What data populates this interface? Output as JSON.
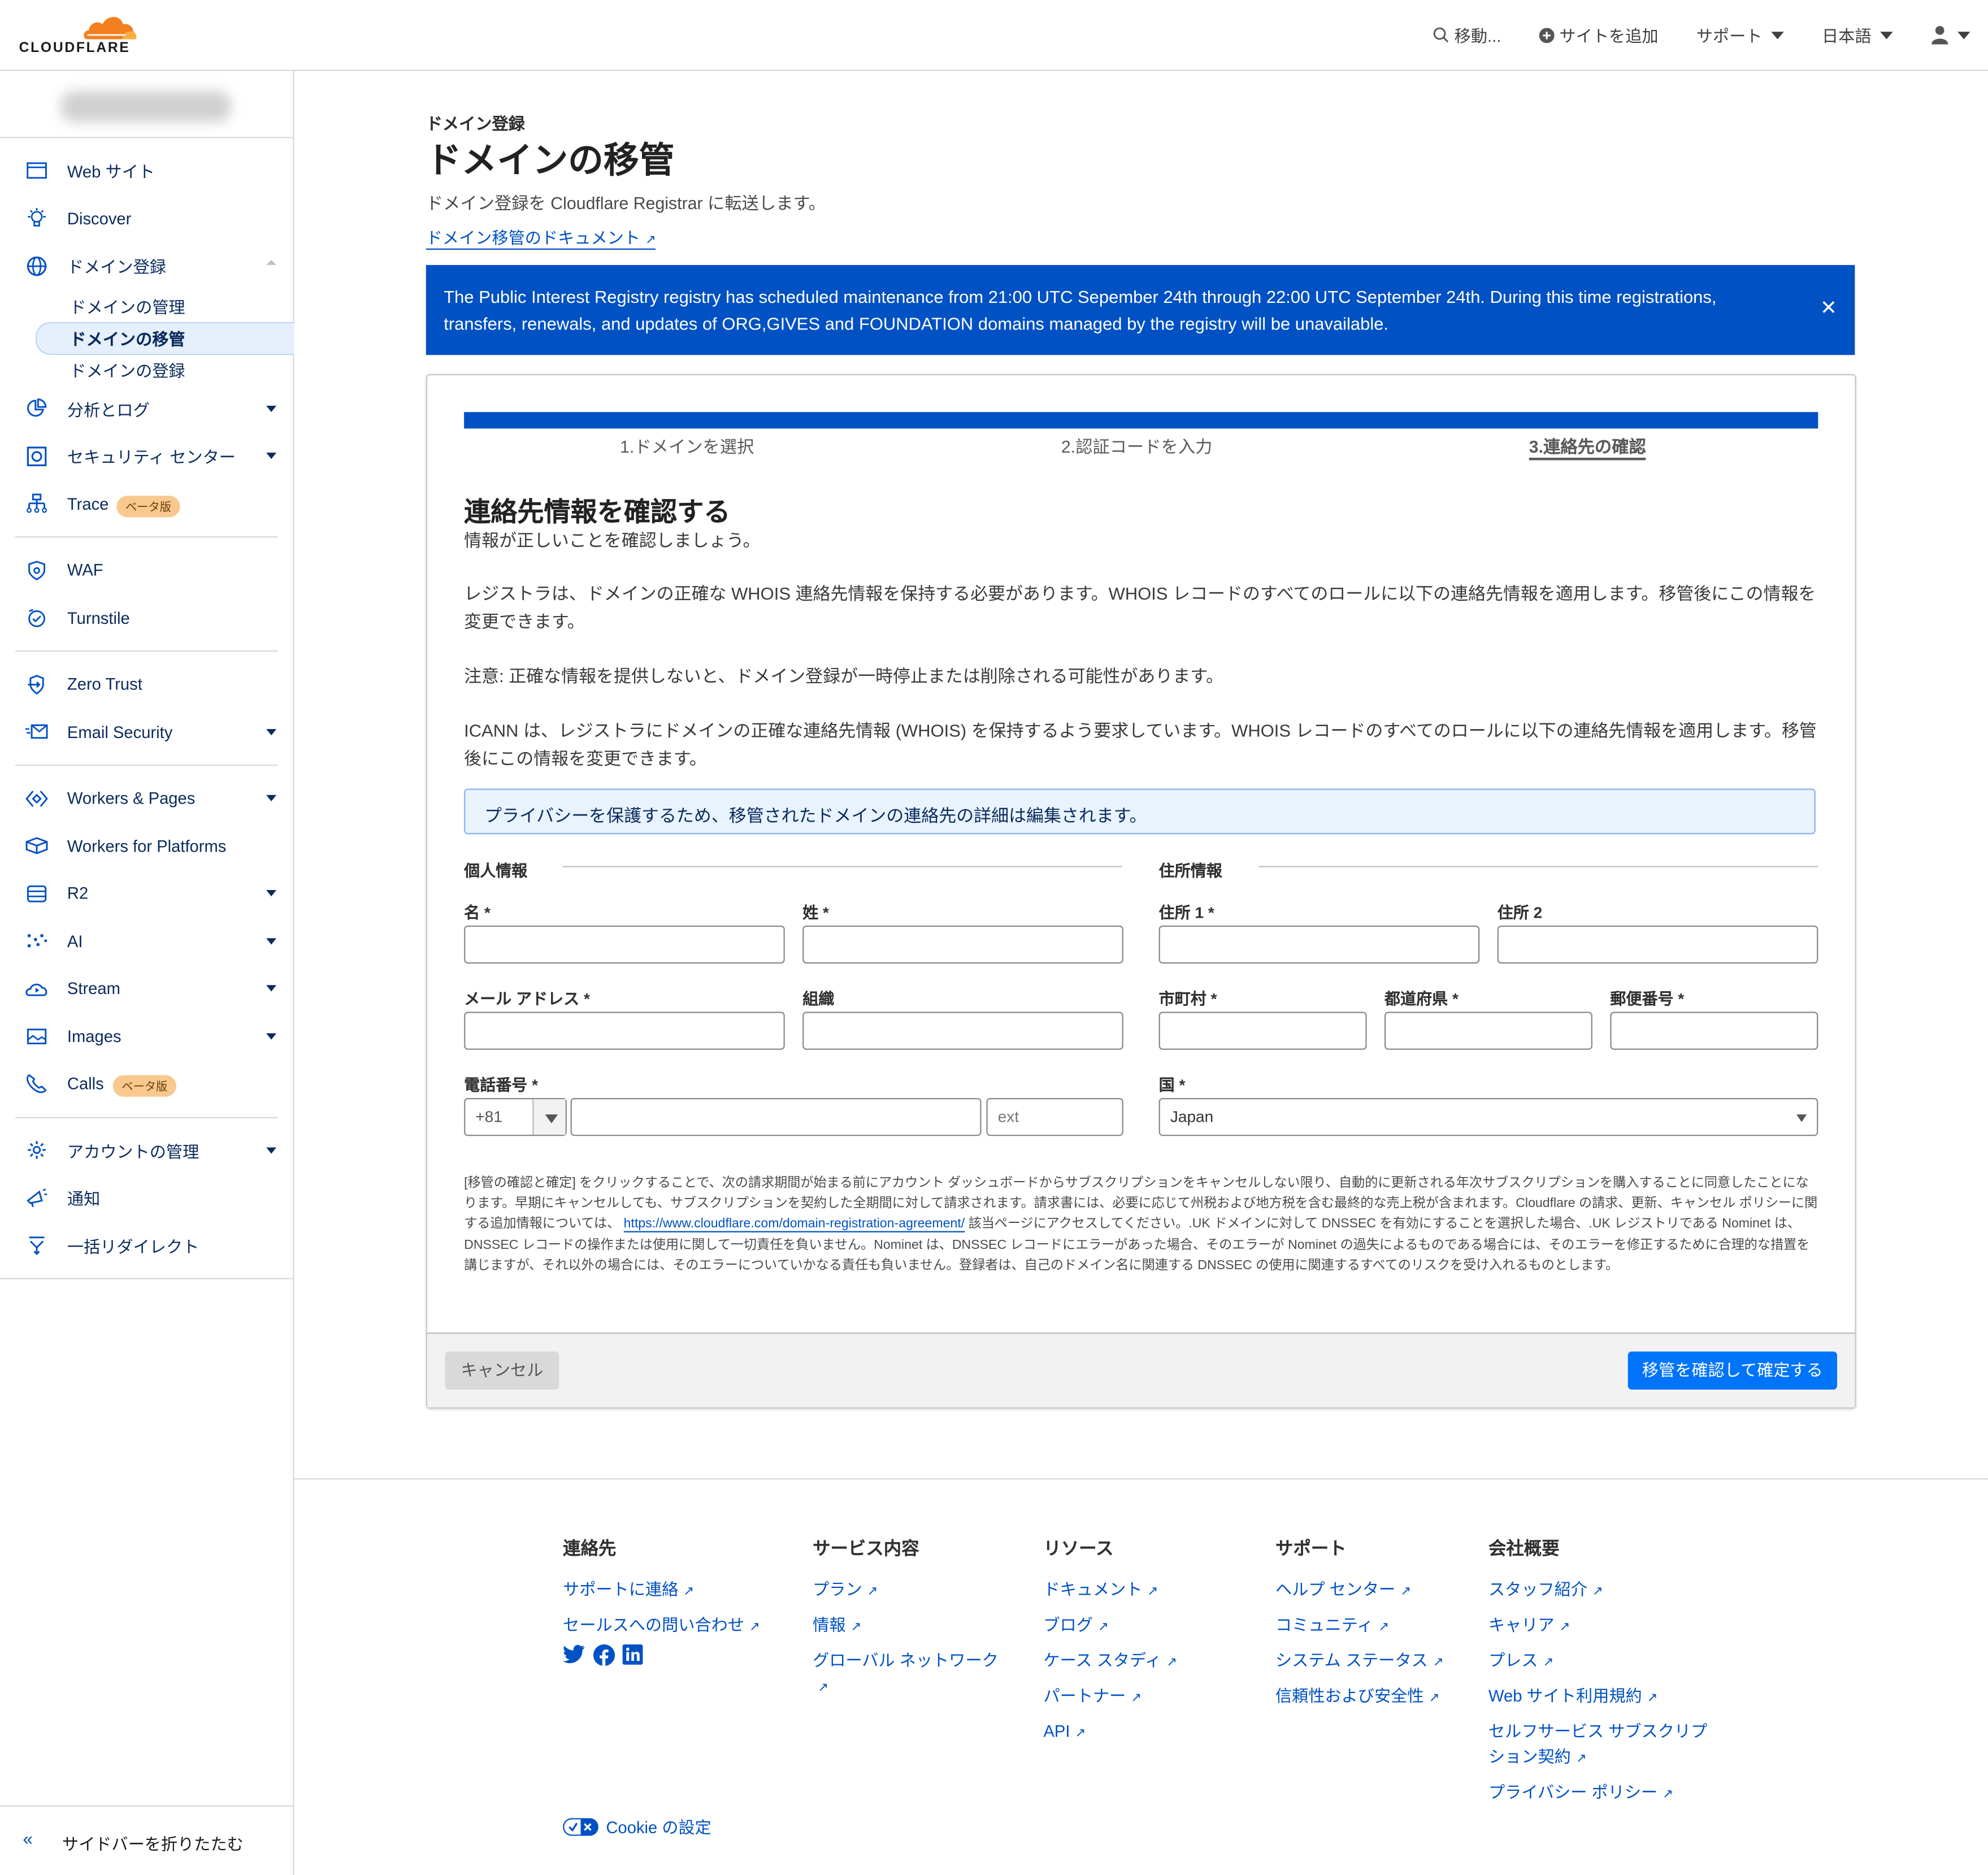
{
  "header": {
    "brand": "CLOUDFLARE",
    "nav": [
      {
        "label": "移動...",
        "icon": "search-icon"
      },
      {
        "label": "サイトを追加",
        "icon": "plus-circle-icon"
      },
      {
        "label": "サポート",
        "dropdown": true
      },
      {
        "label": "日本語",
        "dropdown": true
      },
      {
        "label": "",
        "icon": "user-icon",
        "dropdown": true
      }
    ]
  },
  "sidebar": {
    "items": [
      {
        "label": "Web サイト",
        "icon": "browser-icon"
      },
      {
        "label": "Discover",
        "icon": "lightbulb-icon"
      },
      {
        "label": "ドメイン登録",
        "icon": "globe-icon",
        "expanded": true
      },
      {
        "label": "分析とログ",
        "icon": "pie-chart-icon",
        "dropdown": true
      },
      {
        "label": "セキュリティ センター",
        "icon": "safe-icon",
        "dropdown": true
      },
      {
        "label": "Trace",
        "icon": "network-icon",
        "badge": "ベータ版"
      },
      {
        "label": "WAF",
        "icon": "shield-gear-icon"
      },
      {
        "label": "Turnstile",
        "icon": "turnstile-icon"
      },
      {
        "label": "Zero Trust",
        "icon": "shield-arrow-icon"
      },
      {
        "label": "Email Security",
        "icon": "email-icon",
        "dropdown": true
      },
      {
        "label": "Workers & Pages",
        "icon": "workers-icon",
        "dropdown": true
      },
      {
        "label": "Workers for Platforms",
        "icon": "platforms-icon"
      },
      {
        "label": "R2",
        "icon": "database-icon",
        "dropdown": true
      },
      {
        "label": "AI",
        "icon": "sparkles-icon",
        "dropdown": true
      },
      {
        "label": "Stream",
        "icon": "cloud-play-icon",
        "dropdown": true
      },
      {
        "label": "Images",
        "icon": "image-icon",
        "dropdown": true
      },
      {
        "label": "Calls",
        "icon": "phone-icon",
        "badge": "ベータ版"
      },
      {
        "label": "アカウントの管理",
        "icon": "gear-icon",
        "dropdown": true
      },
      {
        "label": "通知",
        "icon": "megaphone-icon"
      },
      {
        "label": "一括リダイレクト",
        "icon": "redirect-icon"
      }
    ],
    "subitems": [
      {
        "label": "ドメインの管理",
        "active": false
      },
      {
        "label": "ドメインの移管",
        "active": true
      },
      {
        "label": "ドメインの登録",
        "active": false
      }
    ],
    "collapse_label": "サイドバーを折りたたむ"
  },
  "page": {
    "breadcrumb": "ドメイン登録",
    "title": "ドメインの移管",
    "description": "ドメイン登録を Cloudflare Registrar に転送します。",
    "doc_link": "ドメイン移管のドキュメント"
  },
  "banner": {
    "text": "The Public Interest Registry registry has scheduled maintenance from 21:00 UTC Sepember 24th through 22:00 UTC September 24th. During this time registrations, transfers, renewals, and updates of ORG,GIVES and FOUNDATION domains managed by the registry will be unavailable.",
    "close": "✕"
  },
  "wizard": {
    "progress": 1.0,
    "steps": [
      {
        "label": "1.ドメインを選択",
        "current": false
      },
      {
        "label": "2.認証コードを入力",
        "current": false
      },
      {
        "label": "3.連絡先の確認",
        "current": true
      }
    ],
    "heading": "連絡先情報を確認する",
    "subheading": "情報が正しいことを確認しましょう。",
    "para1": "レジストラは、ドメインの正確な WHOIS 連絡先情報を保持する必要があります。WHOIS レコードのすべてのロールに以下の連絡先情報を適用します。移管後にこの情報を変更できます。",
    "para2": "注意: 正確な情報を提供しないと、ドメイン登録が一時停止または削除される可能性があります。",
    "para3": "ICANN は、レジストラにドメインの正確な連絡先情報 (WHOIS) を保持するよう要求しています。WHOIS レコードのすべてのロールに以下の連絡先情報を適用します。移管後にこの情報を変更できます。",
    "privacy_note": "プライバシーを保護するため、移管されたドメインの連絡先の詳細は編集されます。",
    "personal_section": "個人情報",
    "address_section": "住所情報",
    "fields": {
      "first_name": {
        "label": "名 *",
        "value": ""
      },
      "last_name": {
        "label": "姓 *",
        "value": ""
      },
      "email": {
        "label": "メール アドレス *",
        "value": ""
      },
      "org": {
        "label": "組織",
        "value": ""
      },
      "phone": {
        "label": "電話番号 *",
        "country_code": "+81",
        "value": "",
        "ext_placeholder": "ext"
      },
      "address1": {
        "label": "住所 1 *",
        "value": ""
      },
      "address2": {
        "label": "住所 2",
        "value": ""
      },
      "city": {
        "label": "市町村 *",
        "value": ""
      },
      "state": {
        "label": "都道府県 *",
        "value": ""
      },
      "zip": {
        "label": "郵便番号 *",
        "value": ""
      },
      "country": {
        "label": "国 *",
        "value": "Japan"
      }
    },
    "legal_pre": "[移管の確認と確定] をクリックすることで、次の請求期間が始まる前にアカウント ダッシュボードからサブスクリプションをキャンセルしない限り、自動的に更新される年次サブスクリプションを購入することに同意したことになります。早期にキャンセルしても、サブスクリプションを契約した全期間に対して請求されます。請求書には、必要に応じて州税および地方税を含む最終的な売上税が含まれます。Cloudflare の請求、更新、キャンセル ポリシーに関する追加情報については、 ",
    "legal_link": "https://www.cloudflare.com/domain-registration-agreement/",
    "legal_post": " 該当ページにアクセスしてください。.UK ドメインに対して DNSSEC を有効にすることを選択した場合、.UK レジストリである Nominet は、DNSSEC レコードの操作または使用に関して一切責任を負いません。Nominet は、DNSSEC レコードにエラーがあった場合、そのエラーが Nominet の過失によるものである場合には、そのエラーを修正するために合理的な措置を講じますが、それ以外の場合には、そのエラーについていかなる責任も負いません。登録者は、自己のドメイン名に関連する DNSSEC の使用に関連するすべてのリスクを受け入れるものとします。",
    "cancel": "キャンセル",
    "confirm": "移管を確認して確定する"
  },
  "footer": {
    "columns": [
      {
        "title": "連絡先",
        "links": [
          "サポートに連絡",
          "セールスへの問い合わせ"
        ]
      },
      {
        "title": "サービス内容",
        "links": [
          "プラン",
          "情報",
          "グローバル ネットワーク"
        ]
      },
      {
        "title": "リソース",
        "links": [
          "ドキュメント",
          "ブログ",
          "ケース スタディ",
          "パートナー",
          "API"
        ]
      },
      {
        "title": "サポート",
        "links": [
          "ヘルプ センター",
          "コミュニティ",
          "システム ステータス",
          "信頼性および安全性"
        ]
      },
      {
        "title": "会社概要",
        "links": [
          "スタッフ紹介",
          "キャリア",
          "プレス",
          "Web サイト利用規約",
          "セルフサービス サブスクリプション契約",
          "プライバシー ポリシー"
        ]
      }
    ],
    "social": [
      "twitter-icon",
      "facebook-icon",
      "linkedin-icon"
    ],
    "cookie_label": "Cookie の設定"
  },
  "colors": {
    "accent": "#0051c3",
    "brand_orange": "#f38020",
    "primary_button": "#0074fb",
    "badge": "#f8c88e"
  }
}
